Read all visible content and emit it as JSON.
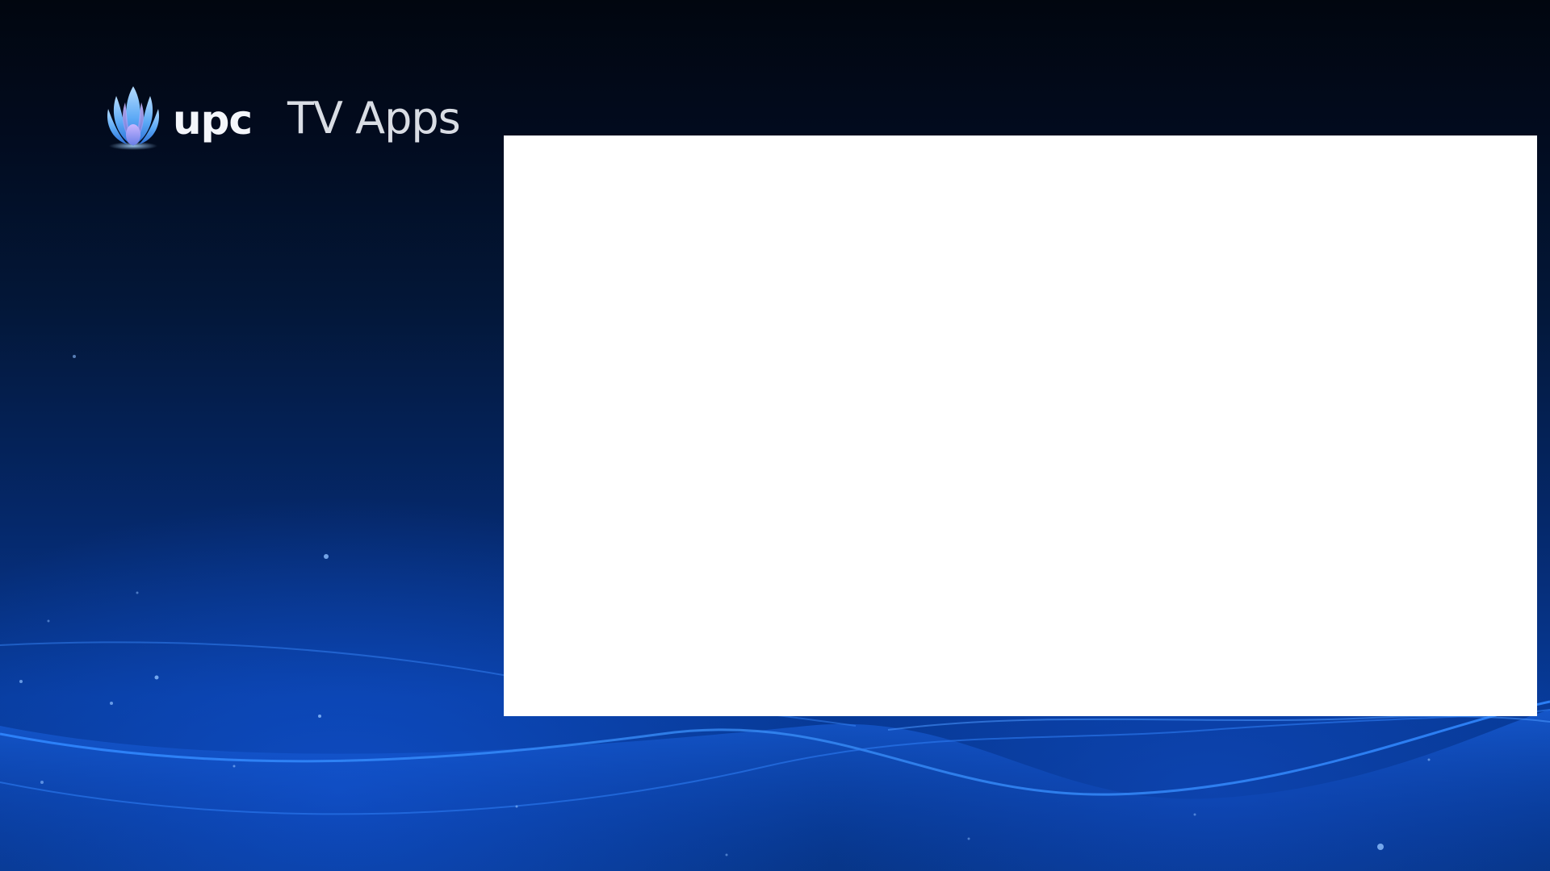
{
  "brand": {
    "logo_icon": "upc-lotus-logo-icon",
    "logo_text": "upc"
  },
  "header": {
    "title": "TV Apps"
  },
  "content": {
    "panel_color": "#ffffff"
  },
  "theme": {
    "background_top": "#01060f",
    "background_bottom": "#073a98",
    "accent": "#1e6cf0"
  }
}
